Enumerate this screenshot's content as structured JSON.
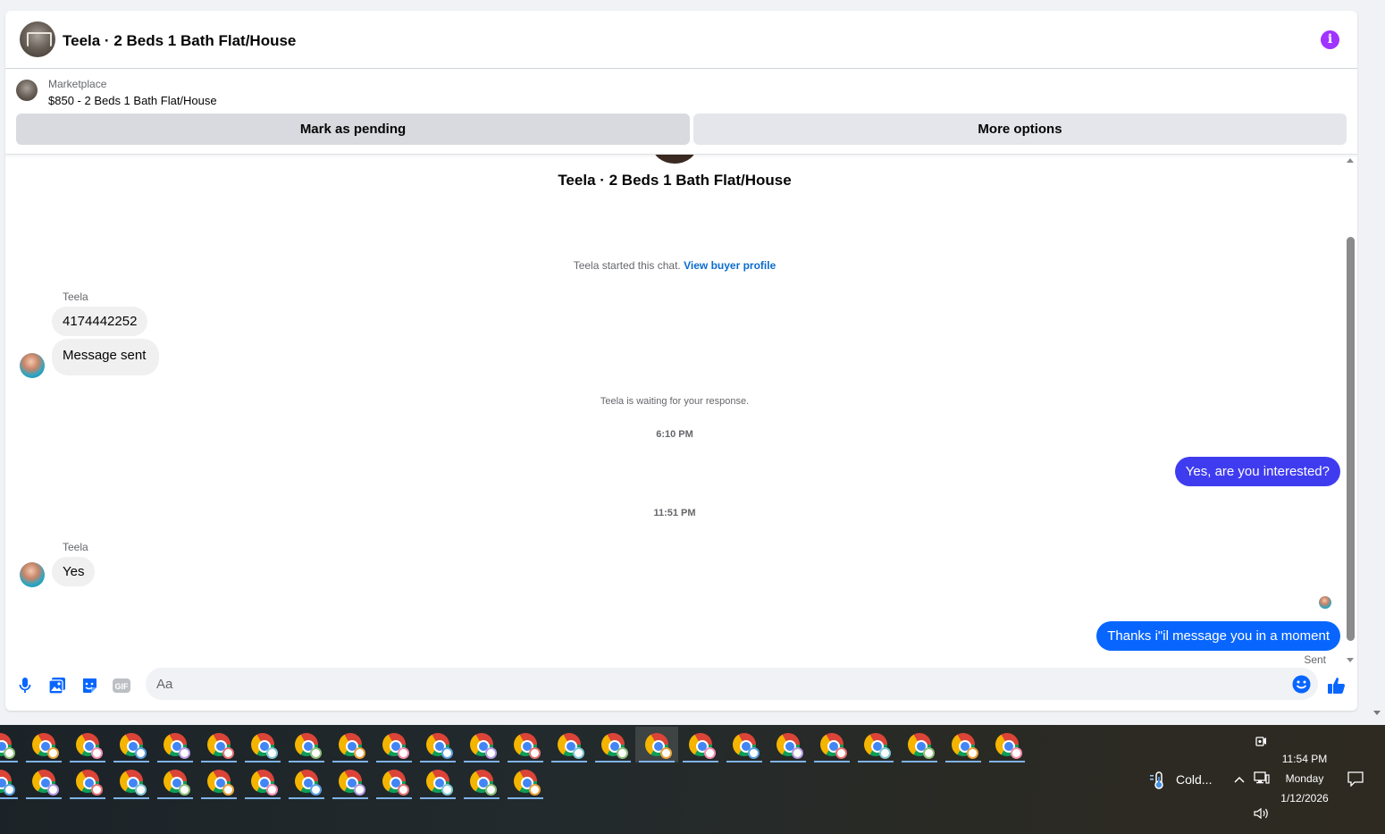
{
  "header": {
    "title": "Teela · 2 Beds 1 Bath Flat/House"
  },
  "listing": {
    "category": "Marketplace",
    "title": "$850 - 2 Beds 1 Bath Flat/House",
    "pending_label": "Mark as pending",
    "more_label": "More options"
  },
  "thread": {
    "title": "Teela · 2 Beds 1 Bath Flat/House",
    "started_text": "Teela started this chat.",
    "buyer_link": "View buyer profile",
    "waiting_text": "Teela is waiting for your response.",
    "sent_status": "Sent"
  },
  "messages": [
    {
      "sender": "Teela",
      "text": "4174442252"
    },
    {
      "text": "Message sent"
    },
    {
      "time": "6:10 PM"
    },
    {
      "text": "Yes, are you interested?"
    },
    {
      "time": "11:51 PM"
    },
    {
      "sender": "Teela",
      "text": "Yes"
    },
    {
      "text": "Thanks i\"il message you in a moment"
    }
  ],
  "composer": {
    "placeholder": "Aa",
    "icons": [
      "microphone-icon",
      "photo-icon",
      "sticker-icon",
      "gif-icon",
      "emoji-icon",
      "thumbs-up-icon"
    ]
  },
  "colors": {
    "outgoing": "#0866ff",
    "outgoing_alt": "#3f3cf0",
    "incoming": "#f0f0f0",
    "accent": "#0866ff",
    "info": "#a033ff"
  },
  "taskbar": {
    "app_rows": [
      24,
      13
    ],
    "app_icon": "chrome-icon",
    "weather": "Cold...",
    "time": "11:54 PM",
    "day": "Monday",
    "date": "1/12/2026"
  }
}
